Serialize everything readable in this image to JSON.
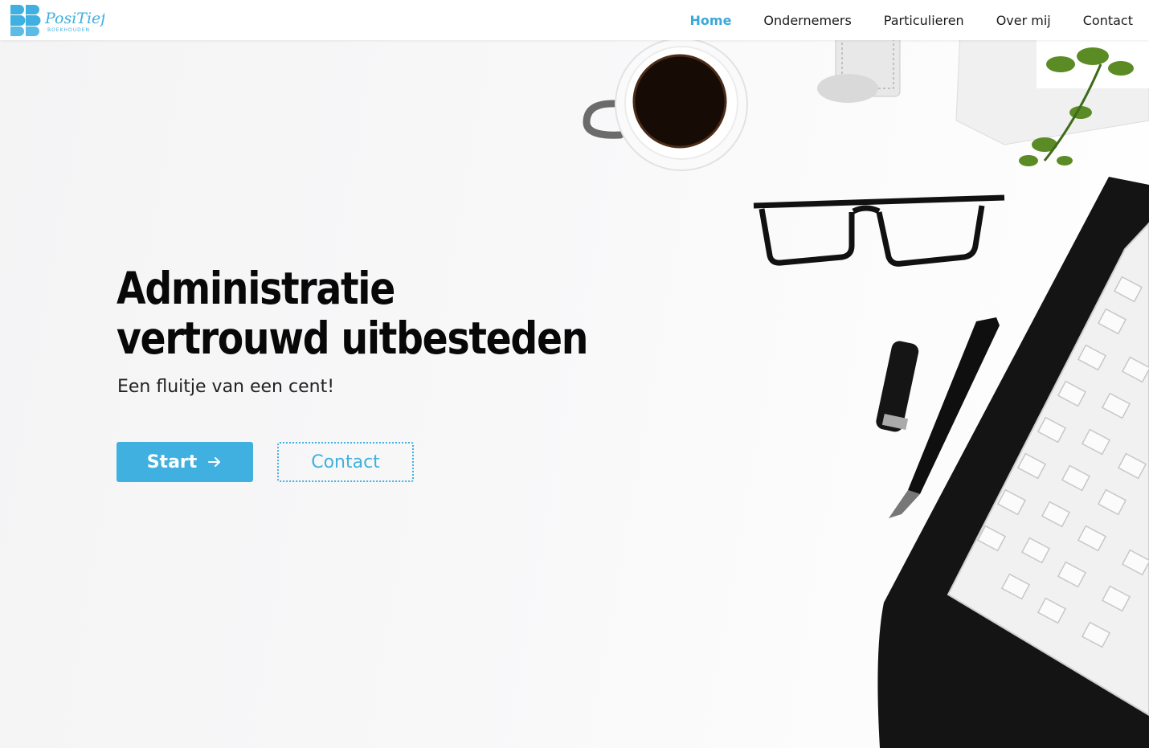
{
  "nav": {
    "logo_text": "PosiTief",
    "logo_sub": "BOEKHOUDEN",
    "items": [
      {
        "label": "Home",
        "active": true
      },
      {
        "label": "Ondernemers",
        "active": false
      },
      {
        "label": "Particulieren",
        "active": false
      },
      {
        "label": "Over mij",
        "active": false
      },
      {
        "label": "Contact",
        "active": false
      }
    ]
  },
  "hero": {
    "title_line1": "Administratie",
    "title_line2": "vertrouwd uitbesteden",
    "subtitle": "Een fluitje van een cent!",
    "start_label": "Start",
    "contact_label": "Contact"
  },
  "colors": {
    "accent": "#3fb0e0",
    "text": "#080808",
    "nav_bg": "#ffffff"
  },
  "icons": {
    "logo": "positief-logo-icon",
    "start_arrow": "arrow-right-icon"
  }
}
